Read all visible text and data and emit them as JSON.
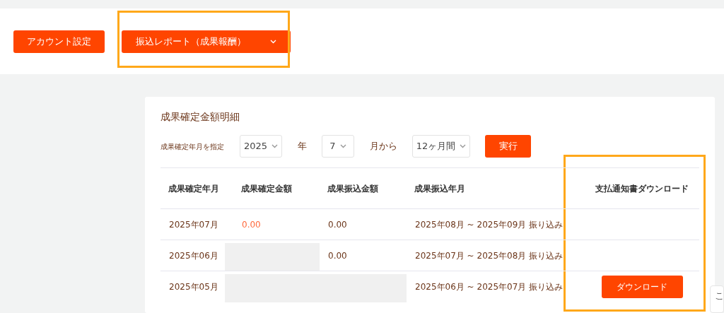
{
  "header": {
    "buttons": [
      {
        "label": "アカウント設定",
        "kind": "plain"
      },
      {
        "label": "振込レポート（成果報酬）",
        "kind": "dropdown",
        "highlighted": true
      }
    ]
  },
  "panel": {
    "title": "成果確定金額明細",
    "filter": {
      "label": "成果確定年月を指定",
      "year": "2025",
      "year_unit": "年",
      "month": "7",
      "month_unit": "月から",
      "period": "12ヶ月間",
      "submit": "実行"
    },
    "table": {
      "columns": [
        {
          "label": "成果確定年月"
        },
        {
          "label": "成果確定金額"
        },
        {
          "label": "成果振込金額"
        },
        {
          "label": "成果振込年月"
        },
        {
          "label": "支払通知書ダウンロード",
          "highlighted": true
        }
      ],
      "rows": [
        {
          "cells": [
            {
              "text": "2025年07月"
            },
            {
              "text": "0.00",
              "accent": true
            },
            {
              "text": "0.00"
            },
            {
              "text": "2025年08月 ~ 2025年09月 振り込み"
            }
          ]
        },
        {
          "cells": [
            {
              "text": "2025年06月"
            },
            {
              "redacted": true
            },
            {
              "text": "0.00"
            },
            {
              "text": "2025年07月 ~ 2025年08月 振り込み"
            }
          ]
        },
        {
          "cells": [
            {
              "text": "2025年05月"
            },
            {
              "redacted": true
            },
            {
              "redacted": true
            },
            {
              "text": "2025年06月 ~ 2025年07月 振り込み"
            }
          ],
          "download": "ダウンロード"
        }
      ]
    }
  },
  "popup_peek": {
    "text": "こ"
  }
}
